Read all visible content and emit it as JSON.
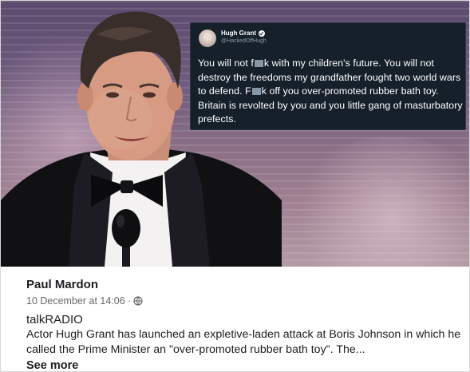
{
  "tweet": {
    "name": "Hugh Grant",
    "handle": "@HackedOffHugh",
    "text_parts": [
      "You will not f",
      "k with my children's future. You will not destroy the freedoms my grandfather fought two world wars to defend. F",
      "k off you over-promoted rubber bath toy. Britain is revolted by you and you little gang of masturbatory prefects."
    ]
  },
  "post": {
    "author": "Paul Mardon",
    "timestamp": "10 December at 14:06 ·",
    "source": "talkRADIO",
    "description": "Actor Hugh Grant has launched an expletive-laden attack at Boris Johnson in which he called the Prime Minister an \"over-promoted rubber bath toy\". The...",
    "see_more": "See more"
  },
  "colors": {
    "tweet_bg": "#15202b",
    "censor": "#8796a3",
    "text_primary": "#1c1e21",
    "text_secondary": "#65676b"
  }
}
